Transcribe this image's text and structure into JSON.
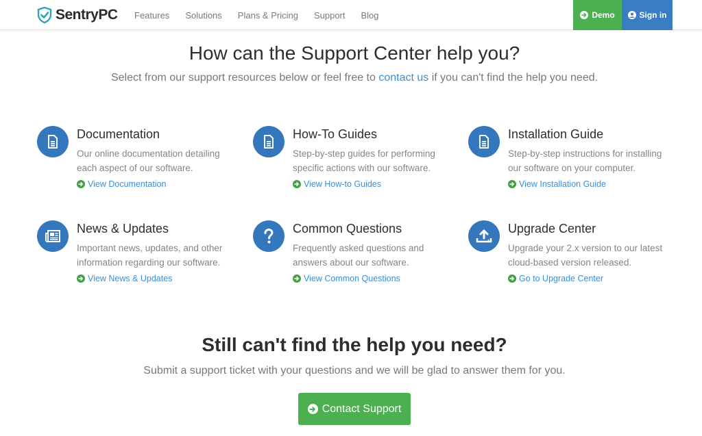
{
  "header": {
    "logo_text": "SentryPC",
    "nav": [
      "Features",
      "Solutions",
      "Plans & Pricing",
      "Support",
      "Blog"
    ],
    "demo_label": "Demo",
    "signin_label": "Sign in"
  },
  "hero": {
    "title": "How can the Support Center help you?",
    "subtitle_before": "Select from our support resources below or feel free to ",
    "subtitle_link": "contact us",
    "subtitle_after": " if you can't find the help you need."
  },
  "cards": [
    {
      "title": "Documentation",
      "desc": "Our online documentation detailing each aspect of our software.",
      "link": "View Documentation",
      "icon": "document-icon"
    },
    {
      "title": "How-To Guides",
      "desc": "Step-by-step guides for performing specific actions with our software.",
      "link": "View How-to Guides",
      "icon": "document-icon"
    },
    {
      "title": "Installation Guide",
      "desc": "Step-by-step instructions for installing our software on your computer.",
      "link": "View Installation Guide",
      "icon": "document-icon"
    },
    {
      "title": "News & Updates",
      "desc": "Important news, updates, and other information regarding our software.",
      "link": "View News & Updates",
      "icon": "newspaper-icon"
    },
    {
      "title": "Common Questions",
      "desc": "Frequently asked questions and answers about our software.",
      "link": "View Common Questions",
      "icon": "question-icon"
    },
    {
      "title": "Upgrade Center",
      "desc": "Upgrade your 2.x version to our latest cloud-based version released.",
      "link": "Go to Upgrade Center",
      "icon": "upload-icon"
    }
  ],
  "bottom": {
    "title": "Still can't find the help you need?",
    "subtitle": "Submit a support ticket with your questions and we will be glad to answer them for you.",
    "button_label": "Contact Support"
  },
  "colors": {
    "brand_blue": "#3577bd",
    "green": "#4caf50",
    "link": "#3b8ed4"
  }
}
